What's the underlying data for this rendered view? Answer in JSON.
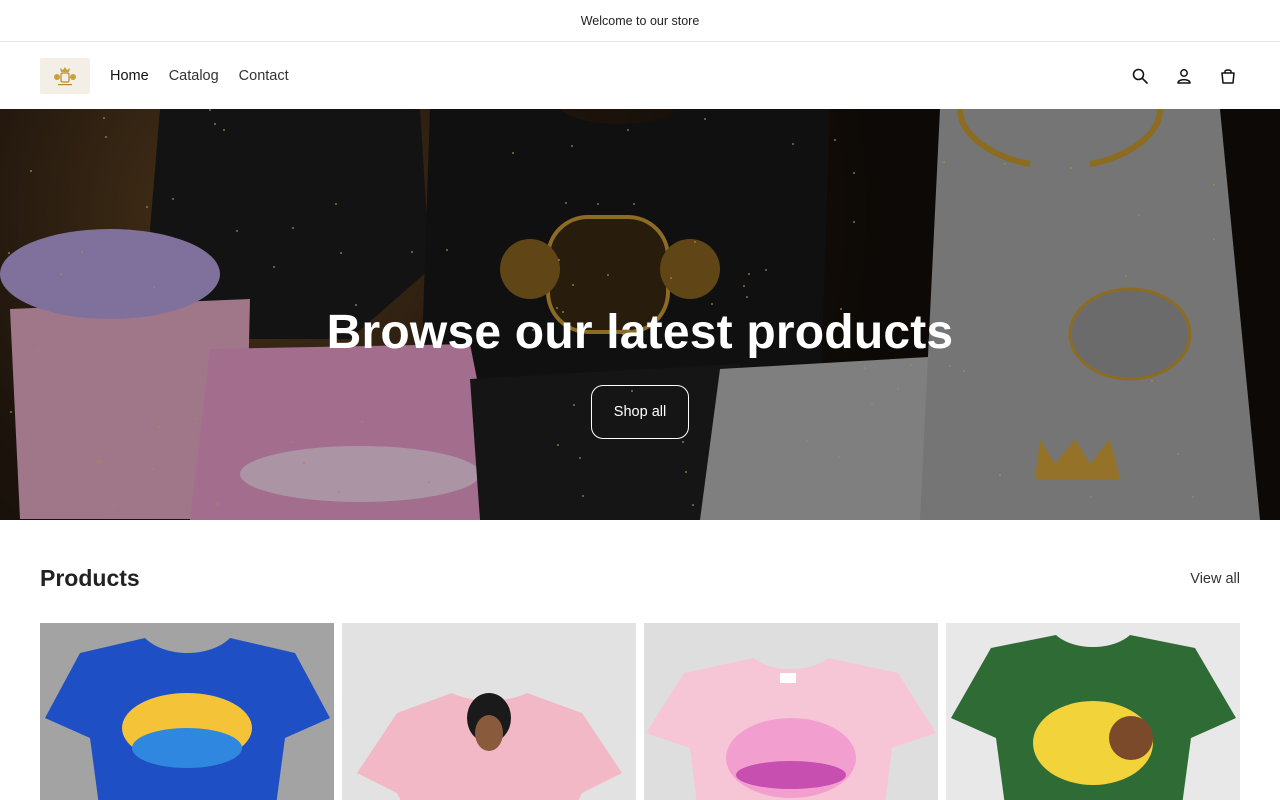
{
  "announcement": {
    "text": "Welcome to our store"
  },
  "header": {
    "logo_icon": "crest-logo-icon",
    "nav": [
      {
        "label": "Home",
        "active": true
      },
      {
        "label": "Catalog",
        "active": false
      },
      {
        "label": "Contact",
        "active": false
      }
    ],
    "icons": [
      "search-icon",
      "account-icon",
      "cart-icon"
    ]
  },
  "hero": {
    "title": "Browse our latest products",
    "button_label": "Shop all"
  },
  "products": {
    "title": "Products",
    "view_all_label": "View all",
    "items": [
      {
        "image": "blue t-shirt with Future Superstar print",
        "shirt_color": "#1f4fc4"
      },
      {
        "image": "pink t-shirt with girl illustration",
        "shirt_color": "#f2b8c6"
      },
      {
        "image": "pink t-shirt with Trendsetter unicorn print",
        "shirt_color": "#f7c6d6"
      },
      {
        "image": "green t-shirt with Jamaica DNA print",
        "shirt_color": "#2f6b35"
      }
    ]
  },
  "colors": {
    "accent": "#121212",
    "border": "#e6e6e6",
    "hero_gold": "#d4a53a"
  }
}
